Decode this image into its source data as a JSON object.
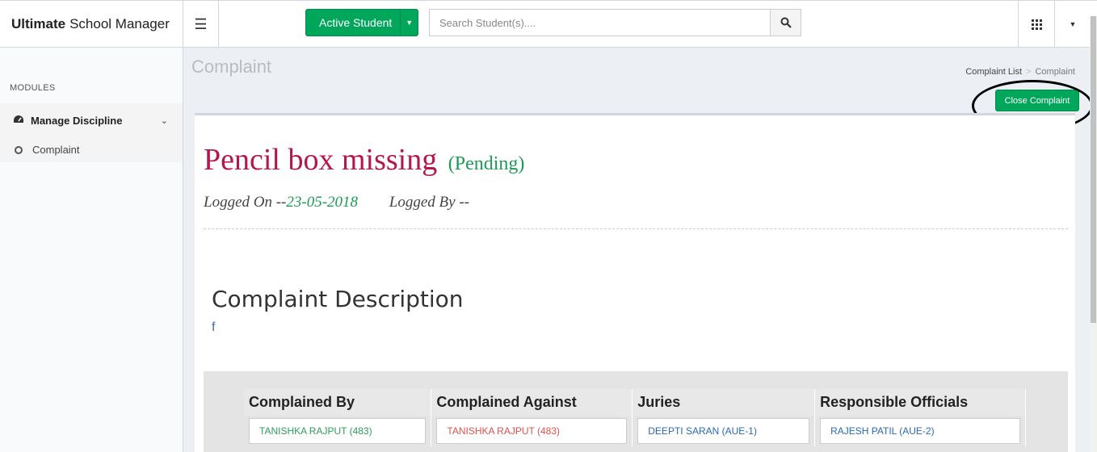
{
  "header": {
    "brand_bold": "Ultimate",
    "brand_rest": "School Manager",
    "active_student_label": "Active Student",
    "search_placeholder": "Search Student(s)...."
  },
  "sidebar": {
    "modules_label": "MODULES",
    "group_label": "Manage Discipline",
    "items": [
      {
        "label": "Complaint"
      }
    ]
  },
  "page": {
    "title": "Complaint",
    "breadcrumb": [
      "Complaint List",
      "Complaint"
    ],
    "close_button": "Close Complaint"
  },
  "complaint": {
    "title": "Pencil box missing",
    "status": "(Pending)",
    "logged_on_label": "Logged On --",
    "logged_on_date": "23-05-2018",
    "logged_by_label": "Logged By --",
    "description_heading": "Complaint Description",
    "description": "f"
  },
  "parties": {
    "headers": [
      "Complained By",
      "Complained Against",
      "Juries",
      "Responsible Officials"
    ],
    "values": [
      "TANISHKA RAJPUT (483)",
      "TANISHKA RAJPUT (483)",
      "DEEPTI SARAN (AUE-1)",
      "RAJESH PATIL (AUE-2)"
    ],
    "colors": [
      "#2e9e5b",
      "#d9534f",
      "#2a6ab0",
      "#2a6ab0"
    ]
  }
}
